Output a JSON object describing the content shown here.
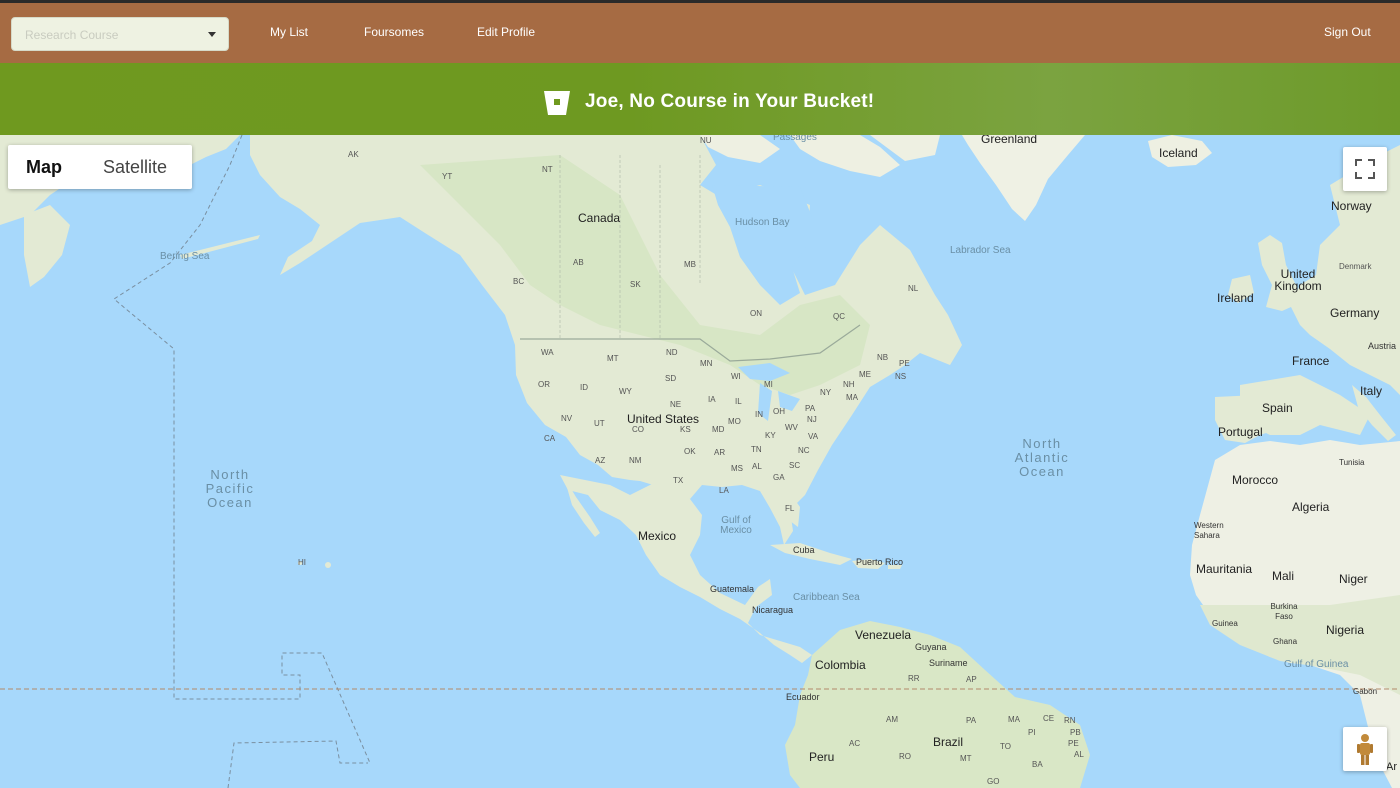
{
  "nav": {
    "course_placeholder": "Research Course",
    "my_list": "My List",
    "foursomes": "Foursomes",
    "edit_profile": "Edit Profile",
    "sign_out": "Sign Out"
  },
  "banner": {
    "title": "Joe, No Course in Your Bucket!",
    "icon": "bucket-icon"
  },
  "map": {
    "type_map": "Map",
    "type_satellite": "Satellite",
    "selected_type": "Map",
    "fullscreen_icon": "fullscreen-icon",
    "pegman_icon": "pegman-icon",
    "labels": {
      "greenland": "Greenland",
      "iceland": "Iceland",
      "passages": "Passages",
      "nu": "NU",
      "nt": "NT",
      "yt": "YT",
      "ak": "AK",
      "canada": "Canada",
      "hudson_bay": "Hudson Bay",
      "labrador_sea": "Labrador Sea",
      "bering_sea": "Bering Sea",
      "ab": "AB",
      "bc": "BC",
      "mb": "MB",
      "sk": "SK",
      "on": "ON",
      "qc": "QC",
      "nl": "NL",
      "norway": "Norway",
      "denmark": "Denmark",
      "united_kingdom": "United Kingdom",
      "ireland": "Ireland",
      "germany": "Germany",
      "austria": "Austria",
      "france": "France",
      "italy": "Italy",
      "spain": "Spain",
      "portugal": "Portugal",
      "wa": "WA",
      "mt": "MT",
      "nd": "ND",
      "mn": "MN",
      "wi": "WI",
      "mi": "MI",
      "ny": "NY",
      "nh": "NH",
      "me": "ME",
      "nb": "NB",
      "pe": "PE",
      "ns": "NS",
      "ma": "MA",
      "or": "OR",
      "id": "ID",
      "wy": "WY",
      "sd": "SD",
      "ne": "NE",
      "ia": "IA",
      "il": "IL",
      "in": "IN",
      "oh": "OH",
      "pa": "PA",
      "nj": "NJ",
      "md": "MD",
      "nv": "NV",
      "ut": "UT",
      "united_states": "United States",
      "co": "CO",
      "ks": "KS",
      "mo": "MO",
      "ky": "KY",
      "wv": "WV",
      "va": "VA",
      "ca": "CA",
      "tn": "TN",
      "nc": "NC",
      "az": "AZ",
      "nm": "NM",
      "ok": "OK",
      "ar": "AR",
      "ms": "MS",
      "al": "AL",
      "ga": "GA",
      "sc": "SC",
      "tx": "TX",
      "la": "LA",
      "fl": "FL",
      "north_atlantic": "North Atlantic Ocean",
      "north_pacific": "North Pacific Ocean",
      "tunisia": "Tunisia",
      "morocco": "Morocco",
      "algeria": "Algeria",
      "western_sahara": "Western Sahara",
      "mauritania": "Mauritania",
      "mali": "Mali",
      "niger": "Niger",
      "burkina_faso": "Burkina Faso",
      "guinea": "Guinea",
      "ghana": "Ghana",
      "nigeria": "Nigeria",
      "gulf_of_guinea": "Gulf of Guinea",
      "gabon": "Gabon",
      "mexico": "Mexico",
      "gulf_of_mexico": "Gulf of Mexico",
      "cuba": "Cuba",
      "puerto_rico": "Puerto Rico",
      "hi": "HI",
      "guatemala": "Guatemala",
      "nicaragua": "Nicaragua",
      "caribbean_sea": "Caribbean Sea",
      "venezuela": "Venezuela",
      "guyana": "Guyana",
      "suriname": "Suriname",
      "colombia": "Colombia",
      "rr": "RR",
      "ap": "AP",
      "ecuador": "Ecuador",
      "am": "AM",
      "pa_br": "PA",
      "ma_br": "MA",
      "ce": "CE",
      "rn": "RN",
      "pb": "PB",
      "pi": "PI",
      "pe_br": "PE",
      "to": "TO",
      "al_br": "AL",
      "brazil": "Brazil",
      "ac": "AC",
      "ro": "RO",
      "mt_br": "MT",
      "ba": "BA",
      "go": "GO",
      "peru": "Peru",
      "ar_lbl": "Ar"
    }
  }
}
